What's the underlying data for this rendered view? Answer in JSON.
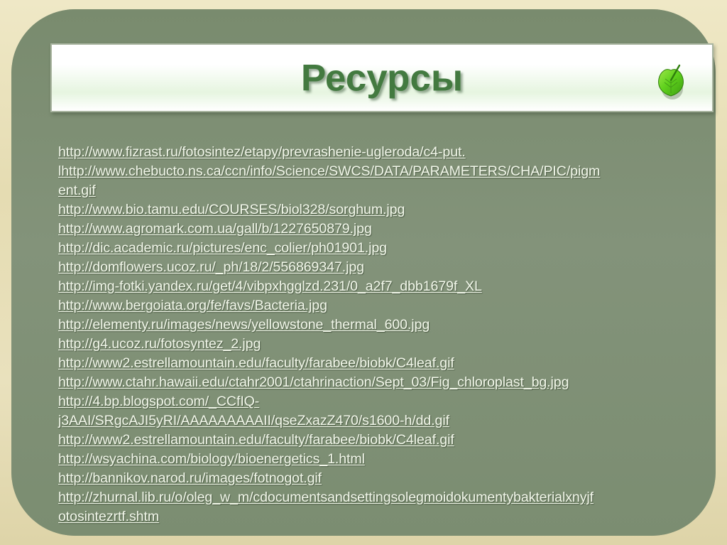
{
  "slide": {
    "title": "Ресурсы",
    "decoration_icon": "leaf-icon",
    "colors": {
      "frame": "#e8dfb8",
      "panel": "#7d8f72",
      "title_text": "#437a40",
      "title_bar_top": "#ffffff",
      "title_bar_mid": "#e6f5e0",
      "link_text": "#f2f7ea"
    }
  },
  "links": [
    "http://www.fizrast.ru/fotosintez/etapy/prevrashenie-ugleroda/c4-put.",
    "lhttp://www.chebucto.ns.ca/ccn/info/Science/SWCS/DATA/PARAMETERS/CHA/PIC/pigm",
    "ent.gif",
    "http://www.bio.tamu.edu/COURSES/biol328/sorghum.jpg",
    "http://www.agromark.com.ua/gall/b/1227650879.jpg",
    "http://dic.academic.ru/pictures/enc_colier/ph01901.jpg",
    "http://domflowers.ucoz.ru/_ph/18/2/556869347.jpg",
    "http://img-fotki.yandex.ru/get/4/vibpxhgglzd.231/0_a2f7_dbb1679f_XL",
    "http://www.bergoiata.org/fe/favs/Bacteria.jpg",
    "http://elementy.ru/images/news/yellowstone_thermal_600.jpg",
    "http://g4.ucoz.ru/fotosyntez_2.jpg",
    "http://www2.estrellamountain.edu/faculty/farabee/biobk/C4leaf.gif",
    "http://www.ctahr.hawaii.edu/ctahr2001/ctahrinaction/Sept_03/Fig_chloroplast_bg.jpg",
    "http://4.bp.blogspot.com/_CCfIQ-",
    "j3AAI/SRgcAJI5yRI/AAAAAAAAAII/qseZxazZ470/s1600-h/dd.gif",
    "http://www2.estrellamountain.edu/faculty/farabee/biobk/C4leaf.gif",
    "http://wsyachina.com/biology/bioenergetics_1.html",
    "http://bannikov.narod.ru/images/fotnogot.gif",
    "http://zhurnal.lib.ru/o/oleg_w_m/cdocumentsandsettingsolegmoidokumentybakterialxnyjf",
    "otosintezrtf.shtm"
  ]
}
